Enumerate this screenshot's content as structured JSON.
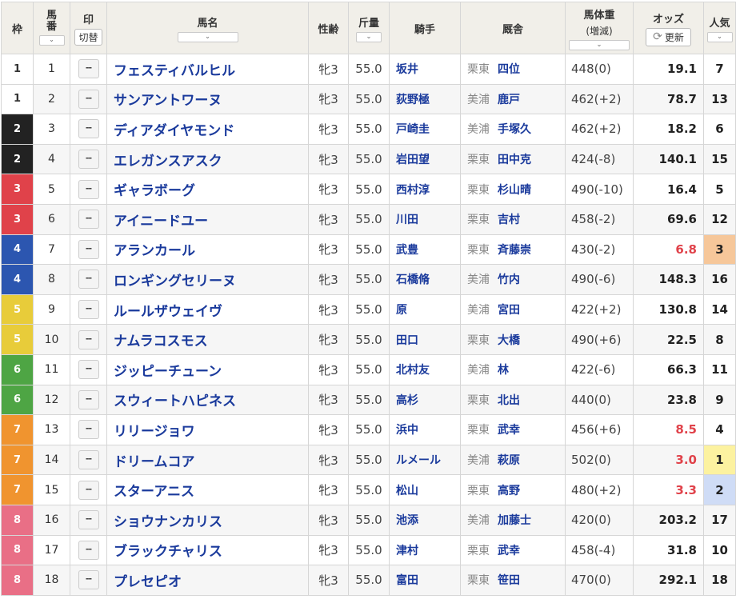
{
  "headers": {
    "waku": "枠",
    "umaban": "馬\n番",
    "mark": "印",
    "kirikae": "切替",
    "horse": "馬名",
    "sexage": "性齢",
    "weight": "斤量",
    "jockey": "騎手",
    "stable": "厩舎",
    "bodyweight_title": "馬体重",
    "bodyweight_sub": "(増減)",
    "odds": "オッズ",
    "refresh": "更新",
    "popularity": "人気"
  },
  "waku_colors": {
    "1": {
      "bg": "#ffffff",
      "fg": "#333333"
    },
    "2": {
      "bg": "#222222",
      "fg": "#ffffff"
    },
    "3": {
      "bg": "#e0424a",
      "fg": "#ffffff"
    },
    "4": {
      "bg": "#2c56b0",
      "fg": "#ffffff"
    },
    "5": {
      "bg": "#e8cc3a",
      "fg": "#ffffff"
    },
    "6": {
      "bg": "#4ea544",
      "fg": "#ffffff"
    },
    "7": {
      "bg": "#f0942f",
      "fg": "#ffffff"
    },
    "8": {
      "bg": "#e96f86",
      "fg": "#ffffff"
    }
  },
  "popularity_highlight": {
    "1": "#fcf2a0",
    "2": "#cfdcf6",
    "3": "#f6c79a"
  },
  "rows": [
    {
      "waku": "1",
      "umaban": "1",
      "mark": "--",
      "horse": "フェスティバルヒル",
      "sexage": "牝3",
      "weight": "55.0",
      "jockey": "坂井",
      "region": "栗東",
      "trainer": "四位",
      "body": "448(0)",
      "odds": "19.1",
      "hot": false,
      "pop": "7"
    },
    {
      "waku": "1",
      "umaban": "2",
      "mark": "--",
      "horse": "サンアントワーヌ",
      "sexage": "牝3",
      "weight": "55.0",
      "jockey": "荻野極",
      "region": "美浦",
      "trainer": "鹿戸",
      "body": "462(+2)",
      "odds": "78.7",
      "hot": false,
      "pop": "13"
    },
    {
      "waku": "2",
      "umaban": "3",
      "mark": "--",
      "horse": "ディアダイヤモンド",
      "sexage": "牝3",
      "weight": "55.0",
      "jockey": "戸崎圭",
      "region": "美浦",
      "trainer": "手塚久",
      "body": "462(+2)",
      "odds": "18.2",
      "hot": false,
      "pop": "6"
    },
    {
      "waku": "2",
      "umaban": "4",
      "mark": "--",
      "horse": "エレガンスアスク",
      "sexage": "牝3",
      "weight": "55.0",
      "jockey": "岩田望",
      "region": "栗東",
      "trainer": "田中克",
      "body": "424(-8)",
      "odds": "140.1",
      "hot": false,
      "pop": "15"
    },
    {
      "waku": "3",
      "umaban": "5",
      "mark": "--",
      "horse": "ギャラボーグ",
      "sexage": "牝3",
      "weight": "55.0",
      "jockey": "西村淳",
      "region": "栗東",
      "trainer": "杉山晴",
      "body": "490(-10)",
      "odds": "16.4",
      "hot": false,
      "pop": "5"
    },
    {
      "waku": "3",
      "umaban": "6",
      "mark": "--",
      "horse": "アイニードユー",
      "sexage": "牝3",
      "weight": "55.0",
      "jockey": "川田",
      "region": "栗東",
      "trainer": "吉村",
      "body": "458(-2)",
      "odds": "69.6",
      "hot": false,
      "pop": "12"
    },
    {
      "waku": "4",
      "umaban": "7",
      "mark": "--",
      "horse": "アランカール",
      "sexage": "牝3",
      "weight": "55.0",
      "jockey": "武豊",
      "region": "栗東",
      "trainer": "斉藤崇",
      "body": "430(-2)",
      "odds": "6.8",
      "hot": true,
      "pop": "3"
    },
    {
      "waku": "4",
      "umaban": "8",
      "mark": "--",
      "horse": "ロンギングセリーヌ",
      "sexage": "牝3",
      "weight": "55.0",
      "jockey": "石橋脩",
      "region": "美浦",
      "trainer": "竹内",
      "body": "490(-6)",
      "odds": "148.3",
      "hot": false,
      "pop": "16"
    },
    {
      "waku": "5",
      "umaban": "9",
      "mark": "--",
      "horse": "ルールザウェイヴ",
      "sexage": "牝3",
      "weight": "55.0",
      "jockey": "原",
      "region": "美浦",
      "trainer": "宮田",
      "body": "422(+2)",
      "odds": "130.8",
      "hot": false,
      "pop": "14"
    },
    {
      "waku": "5",
      "umaban": "10",
      "mark": "--",
      "horse": "ナムラコスモス",
      "sexage": "牝3",
      "weight": "55.0",
      "jockey": "田口",
      "region": "栗東",
      "trainer": "大橋",
      "body": "490(+6)",
      "odds": "22.5",
      "hot": false,
      "pop": "8"
    },
    {
      "waku": "6",
      "umaban": "11",
      "mark": "--",
      "horse": "ジッピーチューン",
      "sexage": "牝3",
      "weight": "55.0",
      "jockey": "北村友",
      "region": "美浦",
      "trainer": "林",
      "body": "422(-6)",
      "odds": "66.3",
      "hot": false,
      "pop": "11"
    },
    {
      "waku": "6",
      "umaban": "12",
      "mark": "--",
      "horse": "スウィートハピネス",
      "sexage": "牝3",
      "weight": "55.0",
      "jockey": "高杉",
      "region": "栗東",
      "trainer": "北出",
      "body": "440(0)",
      "odds": "23.8",
      "hot": false,
      "pop": "9"
    },
    {
      "waku": "7",
      "umaban": "13",
      "mark": "--",
      "horse": "リリージョワ",
      "sexage": "牝3",
      "weight": "55.0",
      "jockey": "浜中",
      "region": "栗東",
      "trainer": "武幸",
      "body": "456(+6)",
      "odds": "8.5",
      "hot": true,
      "pop": "4"
    },
    {
      "waku": "7",
      "umaban": "14",
      "mark": "--",
      "horse": "ドリームコア",
      "sexage": "牝3",
      "weight": "55.0",
      "jockey": "ルメール",
      "region": "美浦",
      "trainer": "萩原",
      "body": "502(0)",
      "odds": "3.0",
      "hot": true,
      "pop": "1"
    },
    {
      "waku": "7",
      "umaban": "15",
      "mark": "--",
      "horse": "スターアニス",
      "sexage": "牝3",
      "weight": "55.0",
      "jockey": "松山",
      "region": "栗東",
      "trainer": "高野",
      "body": "480(+2)",
      "odds": "3.3",
      "hot": true,
      "pop": "2"
    },
    {
      "waku": "8",
      "umaban": "16",
      "mark": "--",
      "horse": "ショウナンカリス",
      "sexage": "牝3",
      "weight": "55.0",
      "jockey": "池添",
      "region": "美浦",
      "trainer": "加藤士",
      "body": "420(0)",
      "odds": "203.2",
      "hot": false,
      "pop": "17"
    },
    {
      "waku": "8",
      "umaban": "17",
      "mark": "--",
      "horse": "ブラックチャリス",
      "sexage": "牝3",
      "weight": "55.0",
      "jockey": "津村",
      "region": "栗東",
      "trainer": "武幸",
      "body": "458(-4)",
      "odds": "31.8",
      "hot": false,
      "pop": "10"
    },
    {
      "waku": "8",
      "umaban": "18",
      "mark": "--",
      "horse": "プレセピオ",
      "sexage": "牝3",
      "weight": "55.0",
      "jockey": "富田",
      "region": "栗東",
      "trainer": "笹田",
      "body": "470(0)",
      "odds": "292.1",
      "hot": false,
      "pop": "18"
    }
  ]
}
